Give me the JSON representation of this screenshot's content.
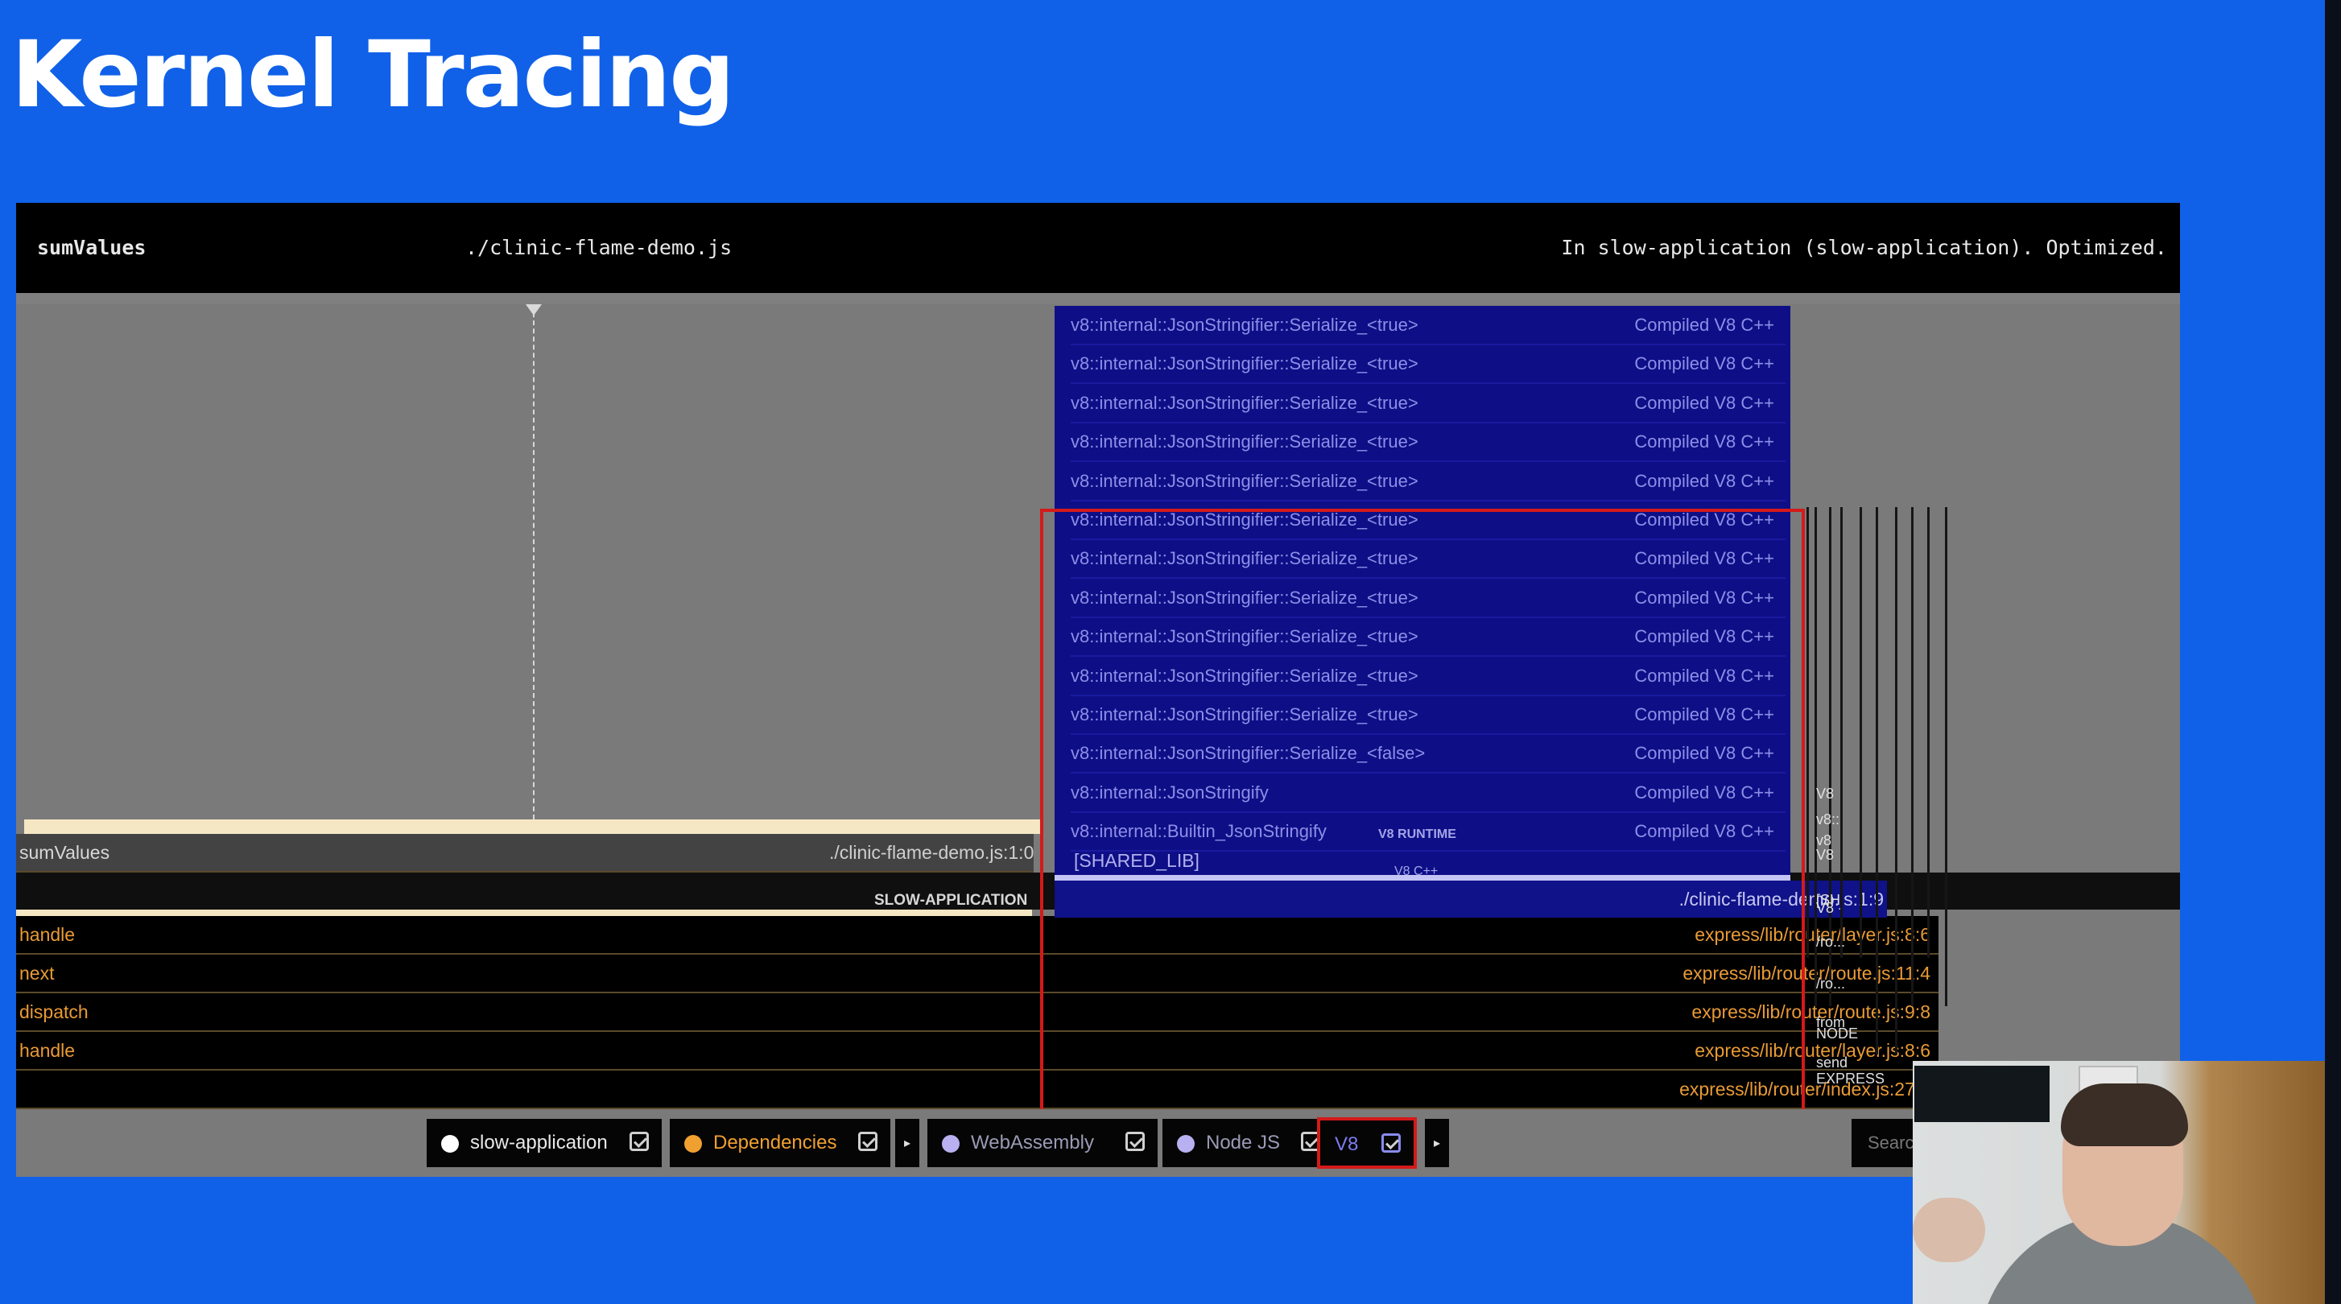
{
  "slide": {
    "title": "Kernel Tracing"
  },
  "tooltip": {
    "function_name": "sumValues",
    "file": "./clinic-flame-demo.js",
    "info": "In slow-application  (slow-application). Optimized."
  },
  "flamegraph": {
    "sum_row": {
      "label": "sumValues",
      "file": "./clinic-flame-demo.js:1:0"
    },
    "slow_app_label": "SLOW-APPLICATION",
    "stack_rows": [
      {
        "label": "handle",
        "location": "express/lib/router/layer.js:8:6"
      },
      {
        "label": "next",
        "location": "express/lib/router/route.js:11:4"
      },
      {
        "label": "dispatch",
        "location": "express/lib/router/route.js:9:8"
      },
      {
        "label": "handle",
        "location": "express/lib/router/layer.js:8:6"
      },
      {
        "label": "",
        "location": "express/lib/router/index.js:27:5"
      }
    ],
    "v8_frames": [
      {
        "label": "v8::internal::JsonStringifier::Serialize_<true>",
        "type": "Compiled V8 C++"
      },
      {
        "label": "v8::internal::JsonStringifier::Serialize_<true>",
        "type": "Compiled V8 C++"
      },
      {
        "label": "v8::internal::JsonStringifier::Serialize_<true>",
        "type": "Compiled V8 C++"
      },
      {
        "label": "v8::internal::JsonStringifier::Serialize_<true>",
        "type": "Compiled V8 C++"
      },
      {
        "label": "v8::internal::JsonStringifier::Serialize_<true>",
        "type": "Compiled V8 C++"
      },
      {
        "label": "v8::internal::JsonStringifier::Serialize_<true>",
        "type": "Compiled V8 C++"
      },
      {
        "label": "v8::internal::JsonStringifier::Serialize_<true>",
        "type": "Compiled V8 C++"
      },
      {
        "label": "v8::internal::JsonStringifier::Serialize_<true>",
        "type": "Compiled V8 C++"
      },
      {
        "label": "v8::internal::JsonStringifier::Serialize_<true>",
        "type": "Compiled V8 C++"
      },
      {
        "label": "v8::internal::JsonStringifier::Serialize_<true>",
        "type": "Compiled V8 C++"
      },
      {
        "label": "v8::internal::JsonStringifier::Serialize_<true>",
        "type": "Compiled V8 C++"
      },
      {
        "label": "v8::internal::JsonStringifier::Serialize_<false>",
        "type": "Compiled V8 C++"
      },
      {
        "label": "v8::internal::JsonStringify",
        "type": "Compiled V8 C++"
      },
      {
        "label": "v8::internal::Builtin_JsonStringify",
        "type": "Compiled V8 C++"
      }
    ],
    "v8_runtime_label": "V8 RUNTIME",
    "v8_cpp_label": "V8 C++",
    "shared_lib_label": "[SHARED_LIB]",
    "v8_file": "./clinic-flame-demo.js:1:9",
    "side_labels": [
      "V8",
      "v8::",
      "v8",
      "V8",
      "[SH",
      "V8",
      "/ro...",
      "/ro...",
      "from",
      "NODE",
      "send",
      "EXPRESS"
    ]
  },
  "toolbar": {
    "filters": [
      {
        "label": "slow-application",
        "dot_color": "#ffffff",
        "text_color": "#e8e8e8"
      },
      {
        "label": "Dependencies",
        "dot_color": "#f0a030",
        "text_color": "#f0a030"
      },
      {
        "label": "WebAssembly",
        "dot_color": "#b8b0f0",
        "text_color": "#9a9ab6"
      },
      {
        "label": "Node JS",
        "dot_color": "#b8b0f0",
        "text_color": "#9a9ab6"
      },
      {
        "label": "V8",
        "dot_color": "",
        "text_color": "#7c7cf0"
      }
    ],
    "expand_arrow": "▸",
    "search_placeholder": "Search"
  },
  "colors": {
    "slide_background": "#1061e8",
    "highlight": "#d41a1a",
    "v8_block": "#0e0f86",
    "dependency_text": "#e99a35"
  }
}
